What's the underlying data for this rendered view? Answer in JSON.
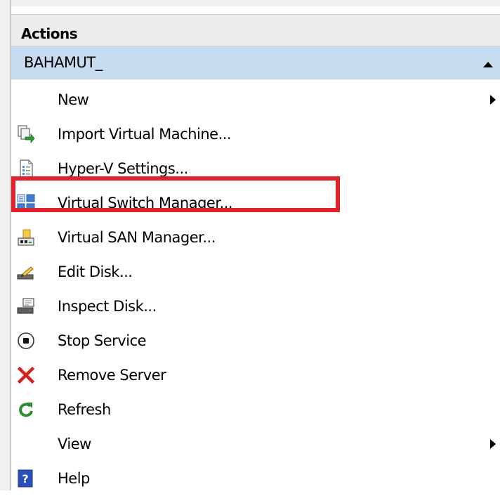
{
  "header": {
    "title": "Actions"
  },
  "server": {
    "name": "BAHAMUT_"
  },
  "items": [
    {
      "label": "New",
      "icon": "none",
      "submenu": true
    },
    {
      "label": "Import Virtual Machine...",
      "icon": "import-vm-icon"
    },
    {
      "label": "Hyper-V Settings...",
      "icon": "settings-document-icon"
    },
    {
      "label": "Virtual Switch Manager...",
      "icon": "network-switch-icon",
      "highlighted": true
    },
    {
      "label": "Virtual SAN Manager...",
      "icon": "san-manager-icon"
    },
    {
      "label": "Edit Disk...",
      "icon": "edit-disk-icon"
    },
    {
      "label": "Inspect Disk...",
      "icon": "inspect-disk-icon"
    },
    {
      "label": "Stop Service",
      "icon": "stop-icon"
    },
    {
      "label": "Remove Server",
      "icon": "remove-x-icon"
    },
    {
      "label": "Refresh",
      "icon": "refresh-icon"
    },
    {
      "label": "View",
      "icon": "none",
      "submenu": true
    },
    {
      "label": "Help",
      "icon": "help-icon"
    }
  ],
  "colors": {
    "highlight_border": "#e0222d",
    "server_bar": "#c7dcf0",
    "header_bg": "#ececec",
    "remove_red": "#d81e1e",
    "refresh_green": "#2e8b2e",
    "help_blue": "#2a4fbf"
  }
}
